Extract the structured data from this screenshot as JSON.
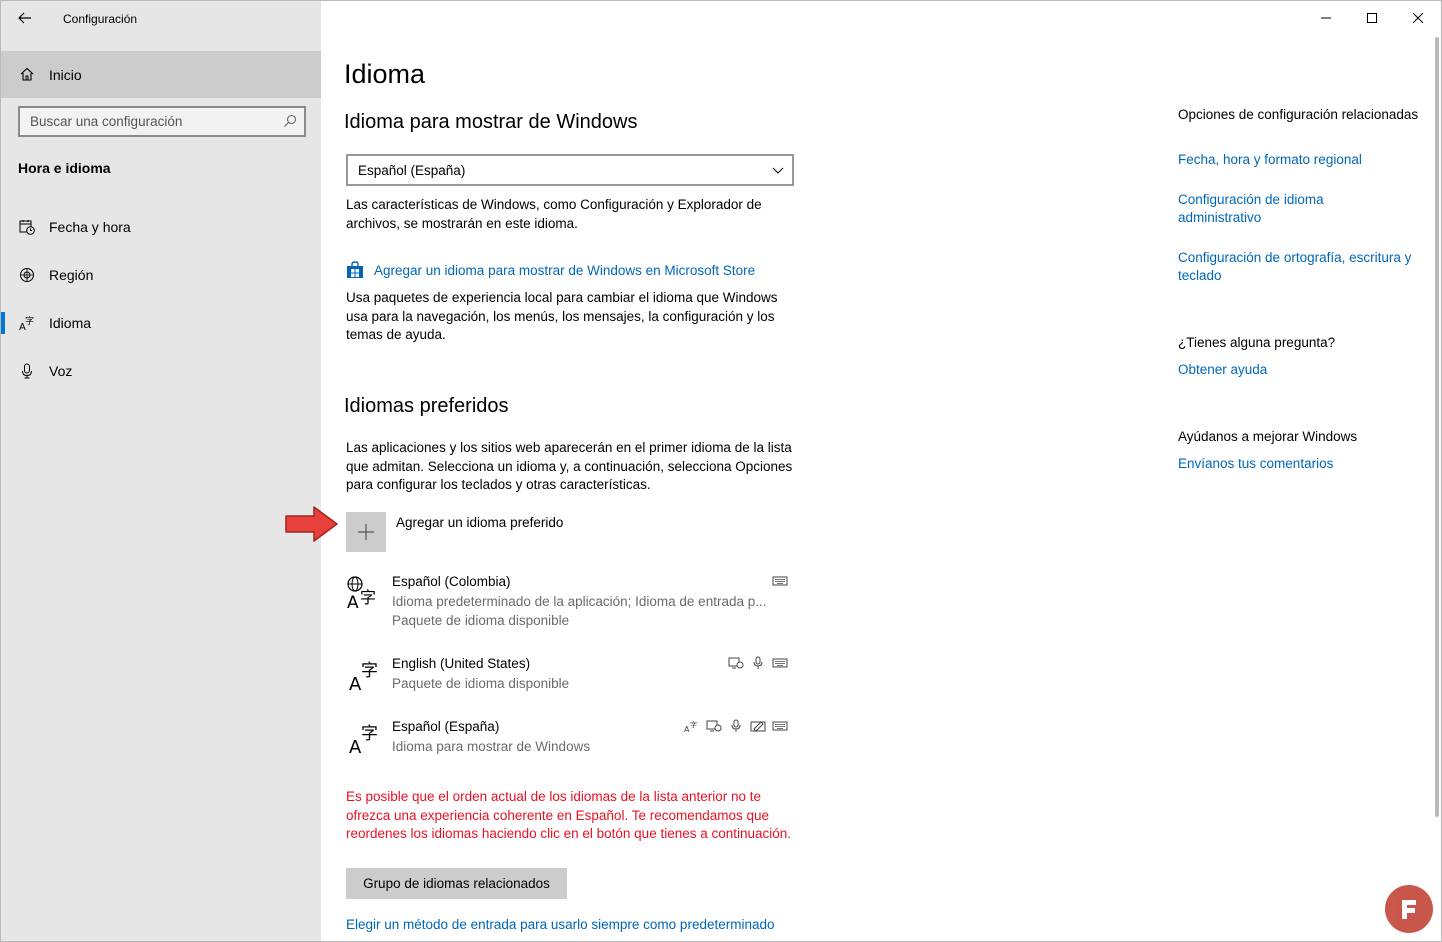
{
  "window": {
    "title": "Configuración"
  },
  "sidebar": {
    "home_label": "Inicio",
    "search_placeholder": "Buscar una configuración",
    "section_title": "Hora e idioma",
    "items": [
      {
        "label": "Fecha y hora",
        "icon": "calendar-clock-icon"
      },
      {
        "label": "Región",
        "icon": "globe-region-icon"
      },
      {
        "label": "Idioma",
        "icon": "language-icon",
        "active": true
      },
      {
        "label": "Voz",
        "icon": "microphone-icon"
      }
    ]
  },
  "main": {
    "page_title": "Idioma",
    "display_language": {
      "heading": "Idioma para mostrar de Windows",
      "selected": "Español (España)",
      "description": "Las características de Windows, como Configuración y Explorador de archivos, se mostrarán en este idioma.",
      "store_link": "Agregar un idioma para mostrar de Windows en Microsoft Store",
      "store_description": "Usa paquetes de experiencia local para cambiar el idioma que Windows usa para la navegación, los menús, los mensajes, la configuración y los temas de ayuda."
    },
    "preferred": {
      "heading": "Idiomas preferidos",
      "description": "Las aplicaciones y los sitios web aparecerán en el primer idioma de la lista que admitan. Selecciona un idioma y, a continuación, selecciona Opciones para configurar los teclados y otras características.",
      "add_label": "Agregar un idioma preferido",
      "languages": [
        {
          "name": "Español (Colombia)",
          "sub1": "Idioma predeterminado de la aplicación; Idioma de entrada p...",
          "sub2": "Paquete de idioma disponible"
        },
        {
          "name": "English (United States)",
          "sub1": "Paquete de idioma disponible"
        },
        {
          "name": "Español (España)",
          "sub1": "Idioma para mostrar de Windows"
        }
      ]
    },
    "warning": "Es posible que el orden actual de los idiomas de la lista anterior no te ofrezca una experiencia coherente en Español. Te recomendamos que reordenes los idiomas haciendo clic en el botón que tienes a continuación.",
    "group_button": "Grupo de idiomas relacionados",
    "input_method_link": "Elegir un método de entrada para usarlo siempre como predeterminado"
  },
  "related": {
    "heading": "Opciones de configuración relacionadas",
    "links": [
      "Fecha, hora y formato regional",
      "Configuración de idioma administrativo",
      "Configuración de ortografía, escritura y teclado"
    ],
    "question_heading": "¿Tienes alguna pregunta?",
    "help_link": "Obtener ayuda",
    "improve_heading": "Ayúdanos a mejorar Windows",
    "feedback_link": "Envíanos tus comentarios"
  },
  "colors": {
    "accent": "#0067b8",
    "warning": "#e81123",
    "sidebar_bg": "#e6e6e6",
    "arrow": "#e8403a"
  }
}
